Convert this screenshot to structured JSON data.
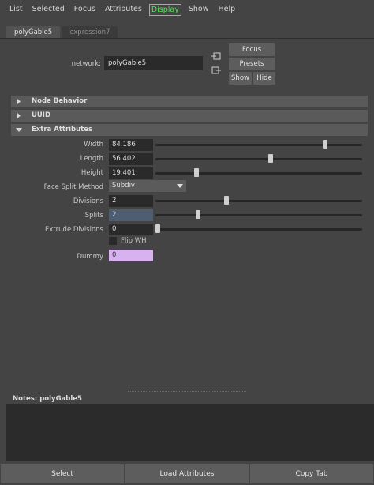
{
  "menu": {
    "items": [
      "List",
      "Selected",
      "Focus",
      "Attributes",
      "Display",
      "Show",
      "Help"
    ]
  },
  "tabs": [
    {
      "label": "polyGable5",
      "active": true
    },
    {
      "label": "expression7",
      "active": false
    }
  ],
  "network": {
    "label": "network:",
    "value": "polyGable5"
  },
  "side_buttons": {
    "focus": "Focus",
    "presets": "Presets",
    "show": "Show",
    "hide": "Hide"
  },
  "sections": {
    "node_behavior": "Node Behavior",
    "uuid": "UUID",
    "extra_attributes": "Extra Attributes"
  },
  "attributes": {
    "width": {
      "label": "Width",
      "value": "84.186",
      "slider_fraction": 0.83
    },
    "length": {
      "label": "Length",
      "value": "56.402",
      "slider_fraction": 0.56
    },
    "height": {
      "label": "Height",
      "value": "19.401",
      "slider_fraction": 0.19
    },
    "face_split": {
      "label": "Face Split Method",
      "value": "Subdiv"
    },
    "divisions": {
      "label": "Divisions",
      "value": "2",
      "slider_fraction": 0.34
    },
    "splits": {
      "label": "Splits",
      "value": "2",
      "slider_fraction": 0.2
    },
    "extrude_divisions": {
      "label": "Extrude Divisions",
      "value": "0",
      "slider_fraction": 0.0
    },
    "flip_wh": {
      "label": "Flip WH",
      "checked": false
    },
    "dummy": {
      "label": "Dummy",
      "value": "0"
    }
  },
  "notes": {
    "label": "Notes:  polyGable5"
  },
  "bottom_buttons": {
    "select": "Select",
    "load_attributes": "Load Attributes",
    "copy_tab": "Copy Tab"
  },
  "colors": {
    "background": "#444444",
    "field": "#2a2a2a",
    "highlight_green": "#58e05a",
    "splits_field": "#4f5d71",
    "dummy_field": "#d7b2ee"
  }
}
